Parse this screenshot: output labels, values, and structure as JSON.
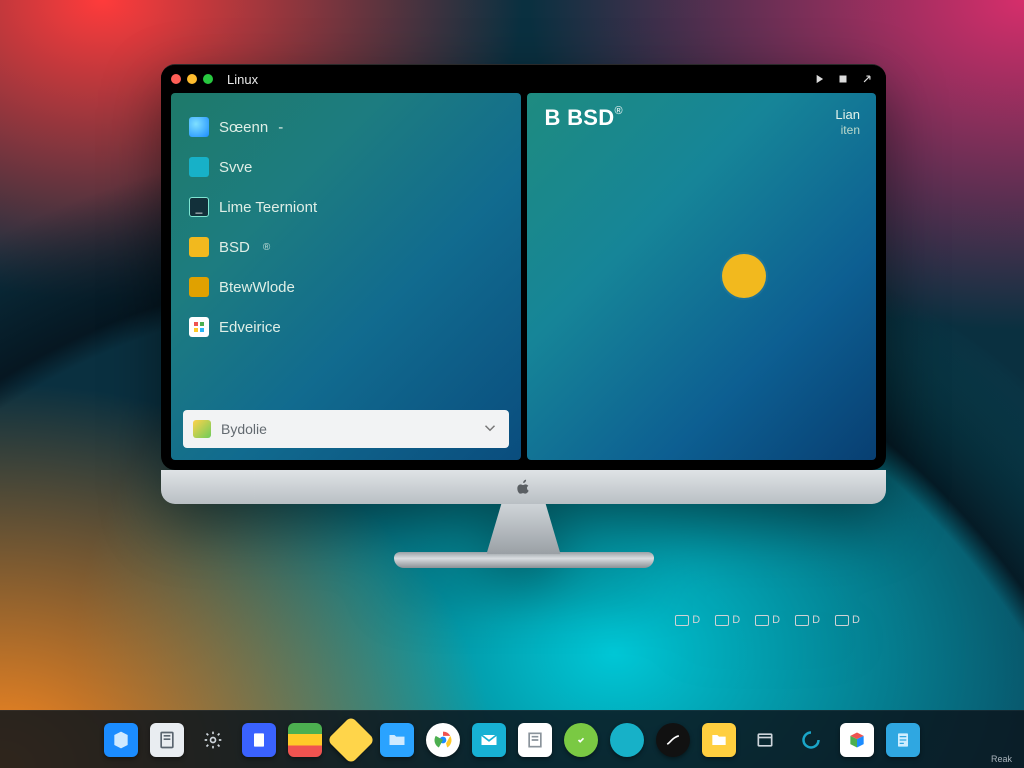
{
  "window": {
    "title": "Linux",
    "controls": {
      "play": "play-icon",
      "stop": "stop-icon",
      "expand": "expand-icon"
    }
  },
  "left_panel": {
    "items": [
      {
        "icon": "globe-icon",
        "label": "Sœenn",
        "suffix": "-"
      },
      {
        "icon": "square-icon",
        "label": "Svve",
        "suffix": ""
      },
      {
        "icon": "terminal-icon",
        "label": "Lime Teerniont",
        "suffix": ""
      },
      {
        "icon": "folder-icon",
        "label": "BSD",
        "suffix": "®"
      },
      {
        "icon": "badge-icon",
        "label": "BtewWlode",
        "suffix": ""
      },
      {
        "icon": "grid-icon",
        "label": "Edveirice",
        "suffix": ""
      }
    ],
    "search_label": "Bydolie"
  },
  "right_panel": {
    "headline": "B BSD",
    "headline_mark": "®",
    "corner_top": "Lian",
    "corner_sub": "iten"
  },
  "bezel_tags": [
    "D",
    "D",
    "D",
    "D",
    "D"
  ],
  "dock": {
    "reak_label": "Reak",
    "items": [
      {
        "name": "cube-app",
        "bg": "#1b8cff"
      },
      {
        "name": "notes-app",
        "bg": "#e9edf1"
      },
      {
        "name": "gear-app",
        "bg": "transparent"
      },
      {
        "name": "docs-app",
        "bg": "#3a62ff"
      },
      {
        "name": "sheets-app",
        "bg": "linear-gradient(#4caf50 33%,#ffca28 33% 66%,#ef5350 66%)"
      },
      {
        "name": "diamond-app",
        "bg": "#ffd54a"
      },
      {
        "name": "folder-app",
        "bg": "#2aa3ff"
      },
      {
        "name": "chrome-app",
        "bg": "#fff"
      },
      {
        "name": "mail-app",
        "bg": "#17b1d4"
      },
      {
        "name": "note2-app",
        "bg": "#fff"
      },
      {
        "name": "shield-app",
        "bg": "#7ac943"
      },
      {
        "name": "circle-app",
        "bg": "#17b1c8"
      },
      {
        "name": "obsidian-app",
        "bg": "#111"
      },
      {
        "name": "files2-app",
        "bg": "#ffcf3f"
      },
      {
        "name": "window-app",
        "bg": "transparent"
      },
      {
        "name": "swirl-app",
        "bg": "#1aa6c9"
      },
      {
        "name": "box-app",
        "bg": "#fff"
      },
      {
        "name": "doc2-app",
        "bg": "#2fa7e1"
      }
    ]
  },
  "colors": {
    "accent_yellow": "#f2b91e",
    "panel_teal": "#1e7a6a"
  }
}
